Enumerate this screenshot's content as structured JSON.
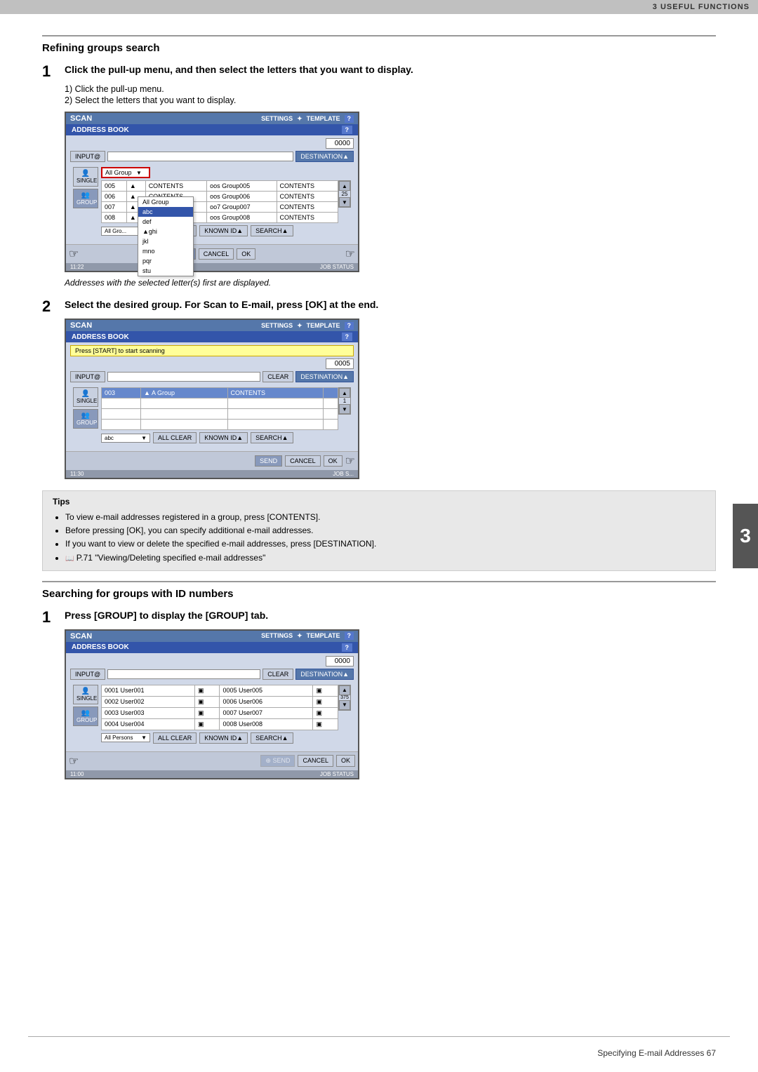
{
  "header": {
    "chapter": "3 USEFUL FUNCTIONS"
  },
  "section1": {
    "title": "Refining groups search",
    "step1": {
      "number": "1",
      "text": "Click the pull-up menu, and then select the letters that you want to display.",
      "substeps": [
        "Click the pull-up menu.",
        "Select the letters that you want to display."
      ],
      "note": "Addresses with the selected letter(s) first are displayed."
    },
    "step2": {
      "number": "2",
      "text": "Select the desired group. For Scan to E-mail, press [OK] at the end."
    }
  },
  "screen1": {
    "app_title": "SCAN",
    "section_title": "ADDRESS BOOK",
    "nav_settings": "SETTINGS",
    "nav_template": "TEMPLATE",
    "help": "?",
    "counter": "0000",
    "destination_btn": "DESTINATION▲",
    "input_label": "INPUT@",
    "dropdown_value": "All Group",
    "dropdown_items": [
      "All Group",
      "abc",
      "def",
      "ghi",
      "jkl",
      "mno",
      "pqr",
      "stu"
    ],
    "active_dropdown": "abc",
    "table_rows": [
      {
        "num": "005",
        "icon": "▲",
        "name": "Group005",
        "contents": "CONTENTS"
      },
      {
        "num": "006",
        "icon": "▲",
        "name": "Group006",
        "contents": "CONTENTS"
      },
      {
        "num": "007",
        "icon": "▲",
        "name": "Group007",
        "contents": "CONTENTS"
      },
      {
        "num": "008",
        "icon": "▲",
        "name": "Group008",
        "contents": "CONTENTS"
      }
    ],
    "all_clear_btn": "ALL CLEAR",
    "known_id_btn": "KNOWN ID▲",
    "search_btn": "SEARCH▲",
    "send_btn": "SEND",
    "cancel_btn": "CANCEL",
    "ok_btn": "OK",
    "job_status": "JOB STATUS",
    "time": "11:22"
  },
  "screen2": {
    "app_title": "SCAN",
    "section_title": "ADDRESS BOOK",
    "notification": "Press [START] to start scanning",
    "counter": "0005",
    "destination_btn": "DESTINATION▲",
    "input_label": "INPUT@",
    "clear_btn": "CLEAR",
    "table_rows": [
      {
        "num": "003",
        "name": "A Group",
        "contents": "CONTENTS",
        "highlighted": true
      }
    ],
    "dropdown_value": "abc",
    "all_clear_btn": "ALL CLEAR",
    "known_id_btn": "KNOWN ID▲",
    "search_btn": "SEARCH▲",
    "send_btn": "SEND",
    "cancel_btn": "CANCEL",
    "ok_btn": "OK",
    "job_status": "JOB S...",
    "time": "11:30"
  },
  "screen3": {
    "app_title": "SCAN",
    "section_title": "ADDRESS BOOK",
    "counter": "0000",
    "destination_btn": "DESTINATION▲",
    "input_label": "INPUT@",
    "clear_btn": "CLEAR",
    "table_rows": [
      {
        "num": "0001",
        "name": "User001",
        "num2": "0005",
        "name2": "User005"
      },
      {
        "num": "0002",
        "name": "User002",
        "num2": "0006",
        "name2": "User006"
      },
      {
        "num": "0003",
        "name": "User003",
        "num2": "0007",
        "name2": "User007"
      },
      {
        "num": "0004",
        "name": "User004",
        "num2": "0008",
        "name2": "User008"
      }
    ],
    "page_count": "375",
    "dropdown_value": "All Persons",
    "all_clear_btn": "ALL CLEAR",
    "known_id_btn": "KNOWN ID▲",
    "search_btn": "SEARCH▲",
    "send_btn": "SEND",
    "cancel_btn": "CANCEL",
    "ok_btn": "OK",
    "job_status": "JOB STATUS",
    "time": "11:00"
  },
  "tips": {
    "title": "Tips",
    "items": [
      "To view e-mail addresses registered in a group, press [CONTENTS].",
      "Before pressing [OK], you can specify additional e-mail addresses.",
      "If you want to view or delete the specified e-mail addresses, press [DESTINATION].",
      "P.71 \"Viewing/Deleting specified e-mail addresses\""
    ]
  },
  "section2": {
    "title": "Searching for groups with ID numbers",
    "step1": {
      "number": "1",
      "text": "Press [GROUP] to display the [GROUP] tab."
    }
  },
  "footer": {
    "text": "Specifying E-mail Addresses   67"
  },
  "side_number": "3"
}
